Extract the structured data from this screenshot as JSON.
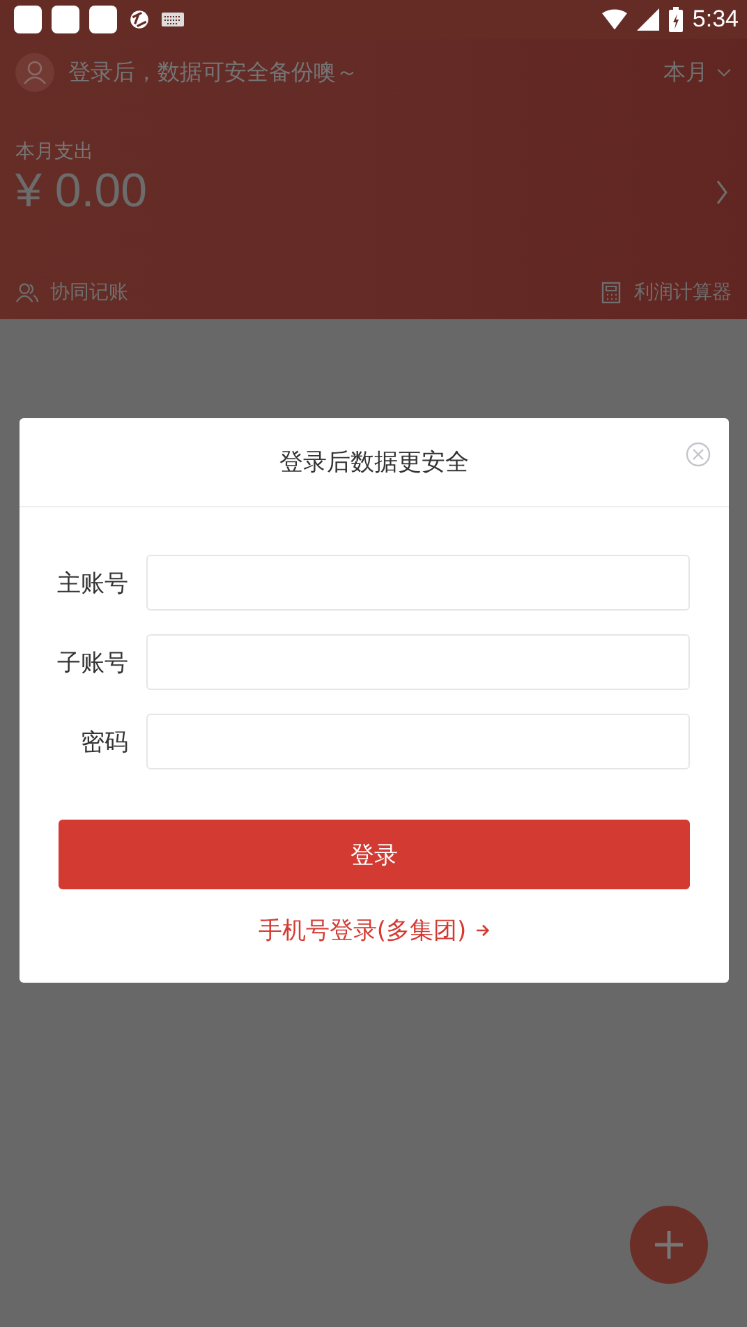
{
  "status_bar": {
    "time": "5:34"
  },
  "header": {
    "login_prompt": "登录后，数据可安全备份噢～",
    "period": "本月",
    "expense_label": "本月支出",
    "expense_amount": "¥ 0.00",
    "links": [
      {
        "kind": "people",
        "label": "协同记账"
      },
      {
        "kind": "calculator",
        "label": "利润计算器"
      }
    ]
  },
  "dialog": {
    "title": "登录后数据更安全",
    "fields": [
      {
        "label": "主账号"
      },
      {
        "label": "子账号"
      },
      {
        "label": "密码"
      }
    ],
    "login_button": "登录",
    "phone_login_link": "手机号登录(多集团)"
  }
}
